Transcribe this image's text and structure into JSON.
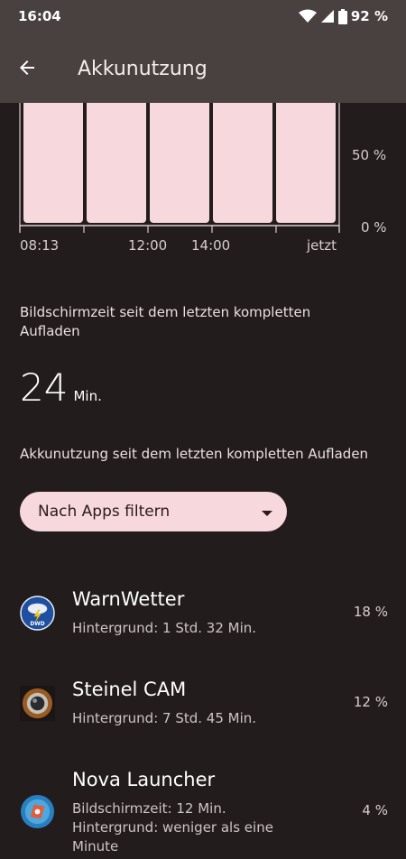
{
  "status": {
    "time": "16:04",
    "battery": "92 %"
  },
  "app_bar": {
    "title": "Akkunutzung"
  },
  "chart": {
    "y_labels": [
      "50 %",
      "0 %"
    ],
    "x_labels": [
      "08:13",
      "12:00",
      "14:00",
      "jetzt"
    ],
    "bar_color": "#f7d8dd"
  },
  "screen_time": {
    "label": "Bildschirmzeit seit dem letzten kompletten Aufladen",
    "value": "24",
    "unit": "Min."
  },
  "usage": {
    "label": "Akkunutzung seit dem letzten kompletten Aufladen"
  },
  "filter": {
    "label": "Nach Apps filtern"
  },
  "apps": [
    {
      "name": "WarnWetter",
      "line1": "Hintergrund: 1 Std. 32 Min.",
      "line2": "",
      "percent": "18 %",
      "icon": "warnwetter-dwd-icon"
    },
    {
      "name": "Steinel CAM",
      "line1": "Hintergrund: 7 Std. 45 Min.",
      "line2": "",
      "percent": "12 %",
      "icon": "camera-lens-icon"
    },
    {
      "name": "Nova Launcher",
      "line1": "Bildschirmzeit: 12 Min.",
      "line2": "Hintergrund: weniger als eine Minute",
      "percent": "4 %",
      "icon": "nova-launcher-icon"
    }
  ],
  "colors": {
    "background": "#231c1d",
    "app_bar": "#49413f",
    "accent": "#f7d8dd"
  }
}
